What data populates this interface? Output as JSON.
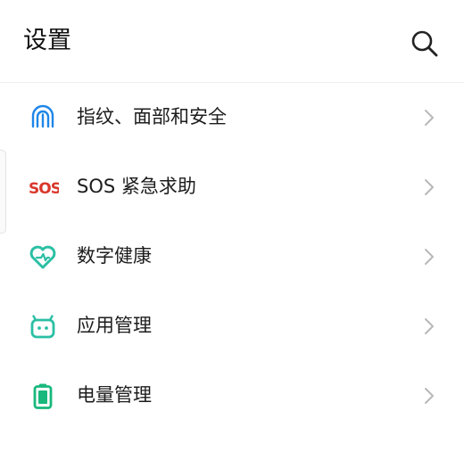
{
  "header": {
    "title": "设置"
  },
  "colors": {
    "fingerprint": "#1e86e8",
    "sos": "#d9372c",
    "teal": "#2bbfa4",
    "battery": "#18b87c",
    "chevron": "#b8b8b8"
  },
  "settings": {
    "items": [
      {
        "label": "指纹、面部和安全",
        "icon": "fingerprint-icon"
      },
      {
        "label": "SOS 紧急求助",
        "icon": "sos-icon",
        "icon_text": "SOS"
      },
      {
        "label": "数字健康",
        "icon": "digital-wellbeing-icon"
      },
      {
        "label": "应用管理",
        "icon": "app-management-icon"
      },
      {
        "label": "电量管理",
        "icon": "battery-icon"
      }
    ]
  }
}
